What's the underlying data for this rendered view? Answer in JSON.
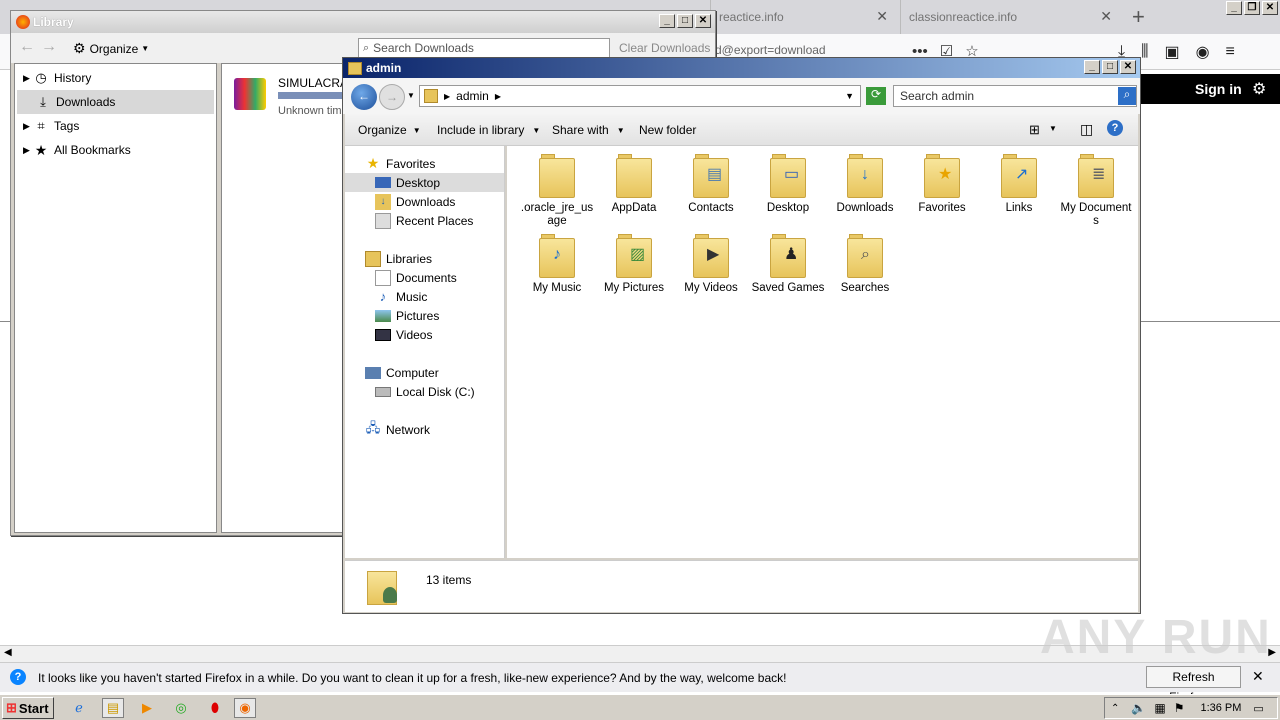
{
  "firefox": {
    "tabs": [
      {
        "title": "reactice.info"
      },
      {
        "title": "classionreactice.info"
      }
    ],
    "new_tab": "+",
    "close_tab": "✕",
    "url_fragment": "d@export=download",
    "sign_in": "Sign in",
    "notification": "It looks like you haven't started Firefox in a while. Do you want to clean it up for a fresh, like-new experience? And by the way, welcome back!",
    "refresh_button": "Refresh Firefox…",
    "close_notification": "✕"
  },
  "library": {
    "title": "Library",
    "organize": "Organize",
    "search_placeholder": "Search Downloads",
    "clear_downloads": "Clear Downloads",
    "tree": [
      {
        "label": "History",
        "icon": "clock-icon",
        "expandable": true
      },
      {
        "label": "Downloads",
        "icon": "download-icon",
        "expandable": false,
        "selected": true
      },
      {
        "label": "Tags",
        "icon": "tag-icon",
        "expandable": true
      },
      {
        "label": "All Bookmarks",
        "icon": "star-icon",
        "expandable": true
      }
    ],
    "download": {
      "name": "SIMULACRA.r",
      "status": "Unknown time"
    }
  },
  "explorer": {
    "title": "admin",
    "breadcrumb": "admin",
    "search_placeholder": "Search admin",
    "commands": [
      "Organize",
      "Include in library",
      "Share with",
      "New folder"
    ],
    "nav": {
      "favorites_header": "Favorites",
      "favorites": [
        "Desktop",
        "Downloads",
        "Recent Places"
      ],
      "libraries_header": "Libraries",
      "libraries": [
        "Documents",
        "Music",
        "Pictures",
        "Videos"
      ],
      "computer_header": "Computer",
      "computer": [
        "Local Disk (C:)"
      ],
      "network_header": "Network"
    },
    "items": [
      {
        "name": ".oracle_jre_usage",
        "icon": "folder-icon"
      },
      {
        "name": "AppData",
        "icon": "folder-icon"
      },
      {
        "name": "Contacts",
        "icon": "contacts-folder-icon"
      },
      {
        "name": "Desktop",
        "icon": "desktop-folder-icon"
      },
      {
        "name": "Downloads",
        "icon": "downloads-folder-icon"
      },
      {
        "name": "Favorites",
        "icon": "favorites-folder-icon"
      },
      {
        "name": "Links",
        "icon": "links-folder-icon"
      },
      {
        "name": "My Documents",
        "icon": "documents-folder-icon"
      },
      {
        "name": "My Music",
        "icon": "music-folder-icon"
      },
      {
        "name": "My Pictures",
        "icon": "pictures-folder-icon"
      },
      {
        "name": "My Videos",
        "icon": "videos-folder-icon"
      },
      {
        "name": "Saved Games",
        "icon": "games-folder-icon"
      },
      {
        "name": "Searches",
        "icon": "search-folder-icon"
      }
    ],
    "status": "13 items"
  },
  "taskbar": {
    "start": "Start",
    "clock": "1:36 PM"
  },
  "watermark": "ANY RUN"
}
